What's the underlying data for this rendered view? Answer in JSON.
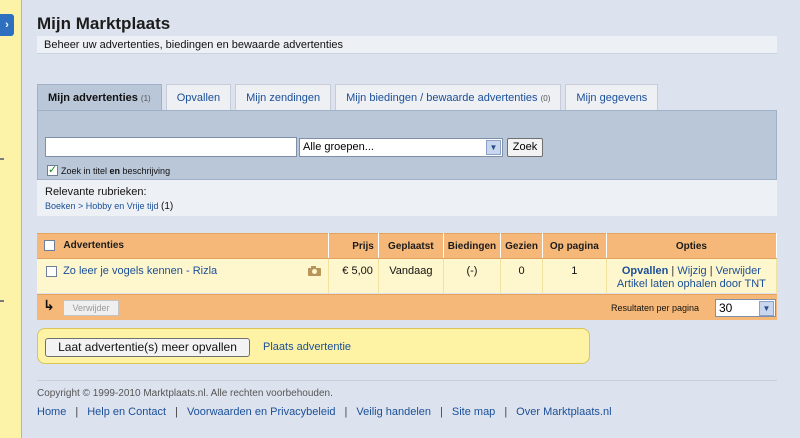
{
  "page": {
    "title": "Mijn Marktplaats",
    "subtitle": "Beheer uw advertenties, biedingen en bewaarde advertenties"
  },
  "left_strip": {
    "button_glyph": "›"
  },
  "tabs": [
    {
      "label": "Mijn advertenties",
      "count": "(1)",
      "active": true
    },
    {
      "label": "Opvallen",
      "count": ""
    },
    {
      "label": "Mijn zendingen",
      "count": ""
    },
    {
      "label": "Mijn biedingen / bewaarde advertenties",
      "count": "(0)"
    },
    {
      "label": "Mijn gegevens",
      "count": ""
    }
  ],
  "search": {
    "input_value": "",
    "group_select": "Alle groepen...",
    "button_label": "Zoek",
    "checkbox_label_pre": "Zoek in titel ",
    "checkbox_label_bold": "en",
    "checkbox_label_post": " beschrijving",
    "checkbox_checked": true
  },
  "rubrieken": {
    "title": "Relevante rubrieken:",
    "path": "Boeken > Hobby en Vrije tijd",
    "count": "(1)"
  },
  "table": {
    "headers": {
      "advertenties": "Advertenties",
      "prijs": "Prijs",
      "geplaatst": "Geplaatst",
      "biedingen": "Biedingen",
      "gezien": "Gezien",
      "op_pagina": "Op pagina",
      "opties": "Opties"
    },
    "rows": [
      {
        "title": "Zo leer je vogels kennen - Rizla",
        "prijs": "€ 5,00",
        "geplaatst": "Vandaag",
        "biedingen": "(-)",
        "gezien": "0",
        "op_pagina": "1",
        "opt_opvallen": "Opvallen",
        "opt_wijzig": "Wijzig",
        "opt_verwijder": "Verwijder",
        "opt_tnt": "Artikel laten ophalen door TNT"
      }
    ],
    "footer": {
      "verwijder_label": "Verwijder",
      "per_page_label": "Resultaten per pagina",
      "per_page_value": "30"
    }
  },
  "actions": {
    "promote_button": "Laat advertentie(s) meer opvallen",
    "place_link": "Plaats advertentie"
  },
  "footer": {
    "copyright": "Copyright © 1999-2010 Marktplaats.nl. Alle rechten voorbehouden.",
    "links": [
      "Home",
      "Help en Contact",
      "Voorwaarden en Privacybeleid",
      "Veilig handelen",
      "Site map",
      "Over Marktplaats.nl"
    ]
  }
}
